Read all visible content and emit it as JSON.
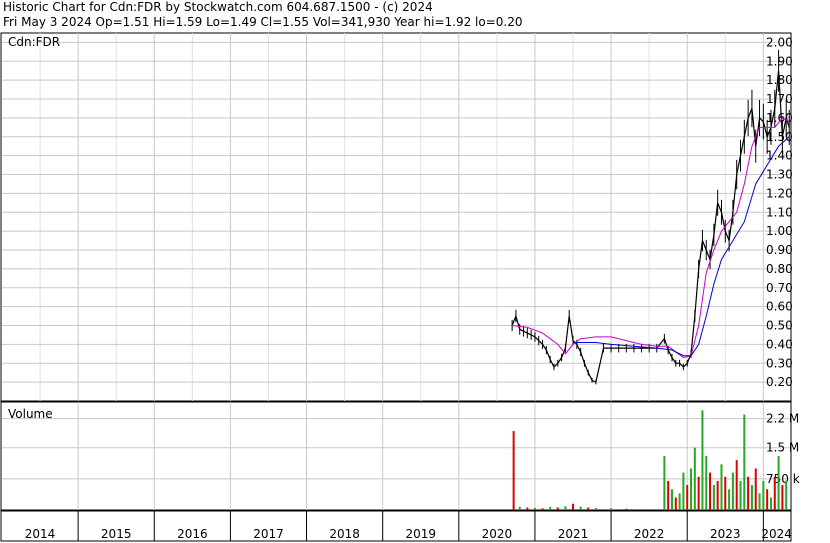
{
  "header": {
    "title": "Historic Chart for Cdn:FDR by Stockwatch.com 604.687.1500 - (c) 2024",
    "summary": "Fri May  3 2024   Op=1.51  Hi=1.59  Lo=1.49  Cl=1.55  Vol=341,930  Year hi=1.92  lo=0.20"
  },
  "colors": {
    "price": "#000000",
    "ma_short": "#cc00cc",
    "ma_long": "#0000cc",
    "volume_up": "#22aa22",
    "volume_down": "#dd0000",
    "down_marks": "#cc0000",
    "grid": "#c8c8c8"
  },
  "chart_data": [
    {
      "type": "line",
      "title": "",
      "series_label": "Cdn:FDR",
      "xlabel": "",
      "ylabel": "",
      "x_range": [
        2014.0,
        2024.35
      ],
      "ylim": [
        0.1,
        2.05
      ],
      "y_ticks": [
        2.0,
        1.9,
        1.8,
        1.7,
        1.6,
        1.5,
        1.4,
        1.3,
        1.2,
        1.1,
        1.0,
        0.9,
        0.8,
        0.7,
        0.6,
        0.5,
        0.4,
        0.3,
        0.2
      ],
      "y_tick_labels": [
        "2.00",
        "1.90",
        "1.80",
        "1.70",
        "1.60",
        "1.50",
        "1.40",
        "1.30",
        "1.20",
        "1.10",
        "1.00",
        "0.90",
        "0.80",
        "0.70",
        "0.60",
        "0.50",
        "0.40",
        "0.30",
        "0.20"
      ],
      "grid": true,
      "series": [
        {
          "role": "price",
          "x": [
            2020.7,
            2020.75,
            2020.8,
            2020.85,
            2020.9,
            2020.95,
            2021.0,
            2021.05,
            2021.1,
            2021.15,
            2021.2,
            2021.25,
            2021.3,
            2021.35,
            2021.4,
            2021.45,
            2021.5,
            2021.55,
            2021.6,
            2021.65,
            2021.7,
            2021.75,
            2021.8,
            2021.9,
            2022.0,
            2022.1,
            2022.2,
            2022.3,
            2022.4,
            2022.5,
            2022.6,
            2022.7,
            2022.75,
            2022.8,
            2022.85,
            2022.9,
            2022.95,
            2023.0,
            2023.05,
            2023.1,
            2023.15,
            2023.2,
            2023.25,
            2023.3,
            2023.35,
            2023.4,
            2023.45,
            2023.5,
            2023.55,
            2023.6,
            2023.65,
            2023.7,
            2023.75,
            2023.8,
            2023.85,
            2023.9,
            2023.95,
            2024.0,
            2024.05,
            2024.1,
            2024.15,
            2024.2,
            2024.25,
            2024.3,
            2024.34
          ],
          "values": [
            0.5,
            0.55,
            0.48,
            0.47,
            0.46,
            0.45,
            0.44,
            0.42,
            0.4,
            0.37,
            0.32,
            0.28,
            0.3,
            0.33,
            0.38,
            0.55,
            0.42,
            0.4,
            0.36,
            0.3,
            0.25,
            0.21,
            0.2,
            0.38,
            0.38,
            0.38,
            0.38,
            0.38,
            0.38,
            0.38,
            0.38,
            0.43,
            0.37,
            0.33,
            0.3,
            0.3,
            0.28,
            0.3,
            0.35,
            0.55,
            0.8,
            0.95,
            0.9,
            0.85,
            0.98,
            1.15,
            1.1,
            1.0,
            0.95,
            1.1,
            1.3,
            1.4,
            1.5,
            1.6,
            1.65,
            1.45,
            1.6,
            1.58,
            1.5,
            1.55,
            1.65,
            1.85,
            1.5,
            1.6,
            1.55
          ]
        },
        {
          "role": "ma_short",
          "x": [
            2020.7,
            2020.9,
            2021.1,
            2021.3,
            2021.4,
            2021.5,
            2021.6,
            2021.8,
            2022.0,
            2022.2,
            2022.4,
            2022.6,
            2022.75,
            2022.85,
            2022.95,
            2023.05,
            2023.15,
            2023.25,
            2023.35,
            2023.45,
            2023.55,
            2023.65,
            2023.75,
            2023.85,
            2023.95,
            2024.05,
            2024.15,
            2024.25,
            2024.34
          ],
          "values": [
            0.5,
            0.49,
            0.46,
            0.4,
            0.35,
            0.4,
            0.43,
            0.44,
            0.44,
            0.42,
            0.4,
            0.39,
            0.39,
            0.36,
            0.33,
            0.34,
            0.5,
            0.78,
            0.9,
            1.0,
            1.05,
            1.1,
            1.25,
            1.45,
            1.55,
            1.55,
            1.55,
            1.6,
            1.58
          ]
        },
        {
          "role": "ma_long",
          "x": [
            2021.5,
            2021.8,
            2022.0,
            2022.3,
            2022.6,
            2022.8,
            2022.95,
            2023.05,
            2023.15,
            2023.25,
            2023.35,
            2023.45,
            2023.6,
            2023.75,
            2023.9,
            2024.05,
            2024.2,
            2024.34
          ],
          "values": [
            0.41,
            0.41,
            0.4,
            0.39,
            0.38,
            0.37,
            0.34,
            0.34,
            0.4,
            0.55,
            0.72,
            0.85,
            0.95,
            1.05,
            1.25,
            1.35,
            1.45,
            1.5
          ]
        }
      ]
    },
    {
      "type": "bar",
      "title": "",
      "series_label": "Volume",
      "ylim": [
        0,
        2600000
      ],
      "y_ticks": [
        2200000,
        1500000,
        750000
      ],
      "y_tick_labels": [
        "2.2 M",
        "1.5 M",
        "750 k"
      ],
      "grid": true,
      "x": [
        2020.72,
        2020.8,
        2020.9,
        2021.0,
        2021.1,
        2021.2,
        2021.3,
        2021.4,
        2021.5,
        2021.6,
        2021.7,
        2021.8,
        2022.0,
        2022.2,
        2022.5,
        2022.7,
        2022.75,
        2022.8,
        2022.85,
        2022.9,
        2022.95,
        2023.0,
        2023.05,
        2023.1,
        2023.15,
        2023.2,
        2023.25,
        2023.3,
        2023.35,
        2023.4,
        2023.45,
        2023.5,
        2023.55,
        2023.6,
        2023.65,
        2023.7,
        2023.75,
        2023.8,
        2023.85,
        2023.9,
        2023.95,
        2024.0,
        2024.05,
        2024.1,
        2024.15,
        2024.2,
        2024.25,
        2024.3
      ],
      "values": [
        1900000,
        80000,
        60000,
        50000,
        40000,
        70000,
        60000,
        90000,
        150000,
        80000,
        60000,
        50000,
        40000,
        30000,
        20000,
        1300000,
        700000,
        500000,
        300000,
        400000,
        900000,
        600000,
        1000000,
        1500000,
        800000,
        2400000,
        1300000,
        900000,
        600000,
        700000,
        1100000,
        800000,
        500000,
        900000,
        1200000,
        700000,
        2300000,
        800000,
        600000,
        1000000,
        400000,
        700000,
        500000,
        300000,
        800000,
        1300000,
        600000,
        700000
      ],
      "up": [
        false,
        true,
        false,
        true,
        false,
        true,
        false,
        true,
        false,
        true,
        false,
        true,
        true,
        false,
        true,
        true,
        false,
        true,
        false,
        true,
        true,
        false,
        true,
        true,
        false,
        true,
        true,
        false,
        true,
        false,
        true,
        false,
        true,
        true,
        false,
        true,
        true,
        false,
        true,
        false,
        true,
        true,
        false,
        true,
        false,
        true,
        false,
        true
      ]
    }
  ],
  "x_axis": {
    "year_labels": [
      "2014",
      "2015",
      "2016",
      "2017",
      "2018",
      "2019",
      "2020",
      "2021",
      "2022",
      "2023",
      "2024"
    ]
  }
}
